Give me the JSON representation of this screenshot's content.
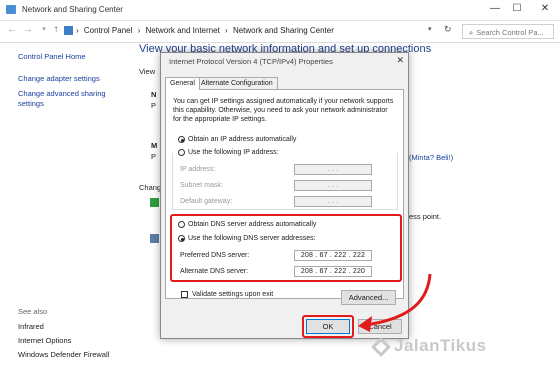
{
  "window": {
    "title": "Network and Sharing Center",
    "minimize": "—",
    "maximize": "☐",
    "close": "✕"
  },
  "address": {
    "crumbs": [
      "Control Panel",
      "›",
      "Network and Internet",
      "›",
      "Network and Sharing Center"
    ],
    "search_placeholder": "Search Control Pa..."
  },
  "sidebar": {
    "home": "Control Panel Home",
    "items": [
      "Change adapter settings",
      "Change advanced sharing settings"
    ],
    "see_also": "See also",
    "see_also_items": [
      "Infrared",
      "Internet Options",
      "Windows Defender Firewall"
    ]
  },
  "main": {
    "heading": "View your basic network information and set up connections",
    "view_label": "View",
    "change_label": "Chang",
    "right_text_1": "(Minta? Beli!)",
    "right_text_2": "ess point."
  },
  "dialog": {
    "title": "Internet Protocol Version 4 (TCP/IPv4) Properties",
    "close": "✕",
    "tabs": [
      "General",
      "Alternate Configuration"
    ],
    "intro": "You can get IP settings assigned automatically if your network supports this capability. Otherwise, you need to ask your network administrator for the appropriate IP settings.",
    "ip_auto": "Obtain an IP address automatically",
    "ip_manual": "Use the following IP address:",
    "ip_fields": [
      {
        "label": "IP address:",
        "value": ". . ."
      },
      {
        "label": "Subnet mask:",
        "value": ". . ."
      },
      {
        "label": "Default gateway:",
        "value": ". . ."
      }
    ],
    "dns_auto": "Obtain DNS server address automatically",
    "dns_manual": "Use the following DNS server addresses:",
    "dns_fields": [
      {
        "label": "Preferred DNS server:",
        "value": "208 . 67 . 222 . 222"
      },
      {
        "label": "Alternate DNS server:",
        "value": "208 . 67 . 222 . 220"
      }
    ],
    "validate": "Validate settings upon exit",
    "advanced": "Advanced...",
    "ok": "OK",
    "cancel": "Cancel"
  },
  "watermark": "JalanTikus",
  "colors": {
    "highlight": "#e21b1b",
    "link": "#1a3e9e"
  }
}
